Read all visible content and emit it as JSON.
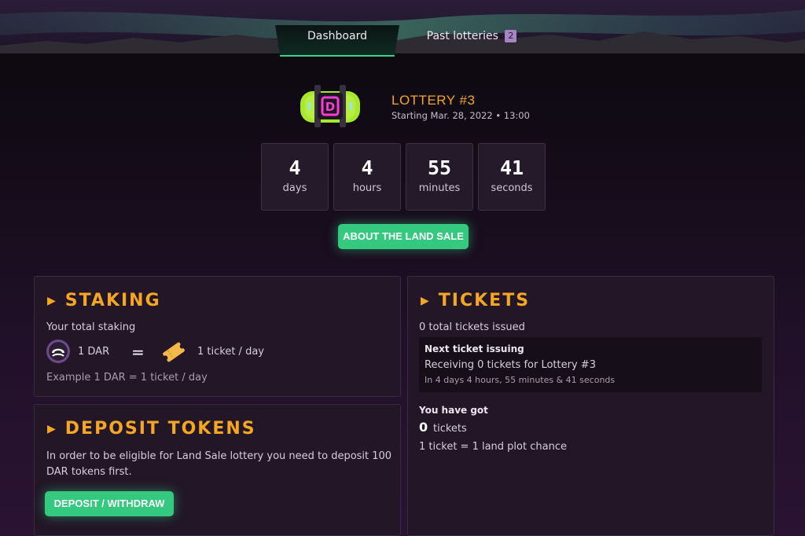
{
  "colors": {
    "accent": "#f5a623",
    "green": "#34c97f",
    "panel": "#221627",
    "background": "#150c18"
  },
  "nav": {
    "tabs": [
      {
        "label": "Dashboard",
        "active": true
      },
      {
        "label": "Past lotteries",
        "badge": "2"
      }
    ]
  },
  "lottery": {
    "title": "LOTTERY #3",
    "starting": "Starting Mar. 28, 2022 • 13:00",
    "icon": "lottery-capsule-icon"
  },
  "countdown": [
    {
      "value": "4",
      "label": "days"
    },
    {
      "value": "4",
      "label": "hours"
    },
    {
      "value": "55",
      "label": "minutes"
    },
    {
      "value": "41",
      "label": "seconds"
    }
  ],
  "land_sale_button": "ABOUT THE LAND SALE",
  "staking": {
    "title": "STAKING",
    "total_label": "Your total staking",
    "dar": "1 DAR",
    "equals": "=",
    "per_day": "1 ticket / day",
    "example": "Example 1 DAR = 1 ticket / day"
  },
  "deposit": {
    "title": "DEPOSIT TOKENS",
    "text": "In order to be eligible for Land Sale lottery you need to deposit 100 DAR tokens first.",
    "button": "DEPOSIT / WITHDRAW"
  },
  "tickets": {
    "title": "TICKETS",
    "issued": "0 total tickets issued",
    "next": {
      "heading": "Next ticket issuing",
      "receiving": "Receiving 0 tickets for Lottery #3",
      "eta": "In 4 days 4 hours, 55 minutes & 41 seconds"
    },
    "got_label": "You have got",
    "got_count": "0",
    "got_unit": "tickets",
    "ratio": "1 ticket = 1 land plot chance"
  }
}
